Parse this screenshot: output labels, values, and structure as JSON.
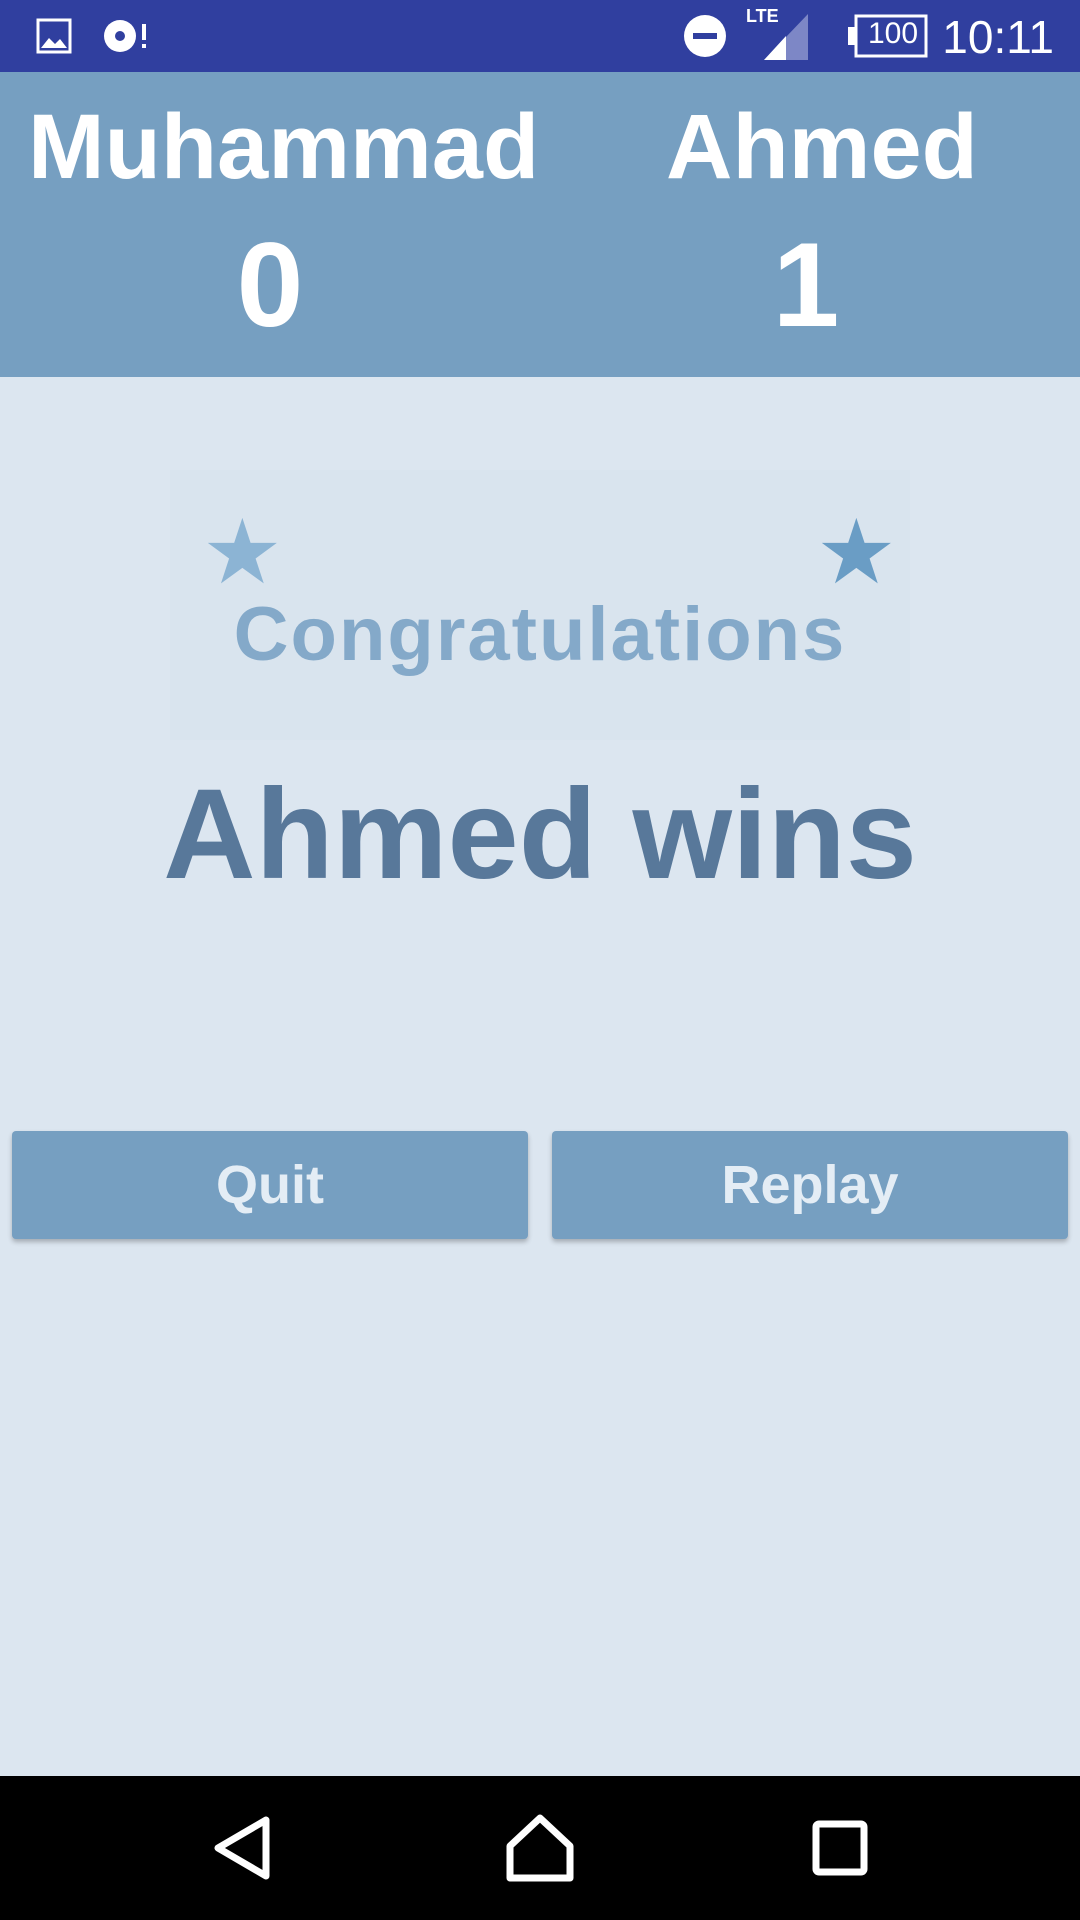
{
  "status_bar": {
    "time": "10:11",
    "battery_level": "100",
    "network_type": "LTE",
    "icons": [
      "image-icon",
      "music-alert-icon",
      "do-not-disturb-icon",
      "signal-icon",
      "battery-icon"
    ]
  },
  "players": [
    {
      "name": "Muhammad",
      "score": "0"
    },
    {
      "name": "Ahmed",
      "score": "1"
    }
  ],
  "result": {
    "congrats_label": "Congratulations",
    "winner_message": "Ahmed wins"
  },
  "buttons": {
    "quit_label": "Quit",
    "replay_label": "Replay"
  },
  "nav_bar": {
    "icons": [
      "back-icon",
      "home-icon",
      "recents-icon"
    ]
  },
  "colors": {
    "status_bar": "#303f9f",
    "header": "#769fc1",
    "background": "#dce6f0",
    "winner_text": "#58789a",
    "congrats_text": "#84a9c9",
    "star_left": "#8cb4d4",
    "star_right": "#6a9dc5"
  }
}
